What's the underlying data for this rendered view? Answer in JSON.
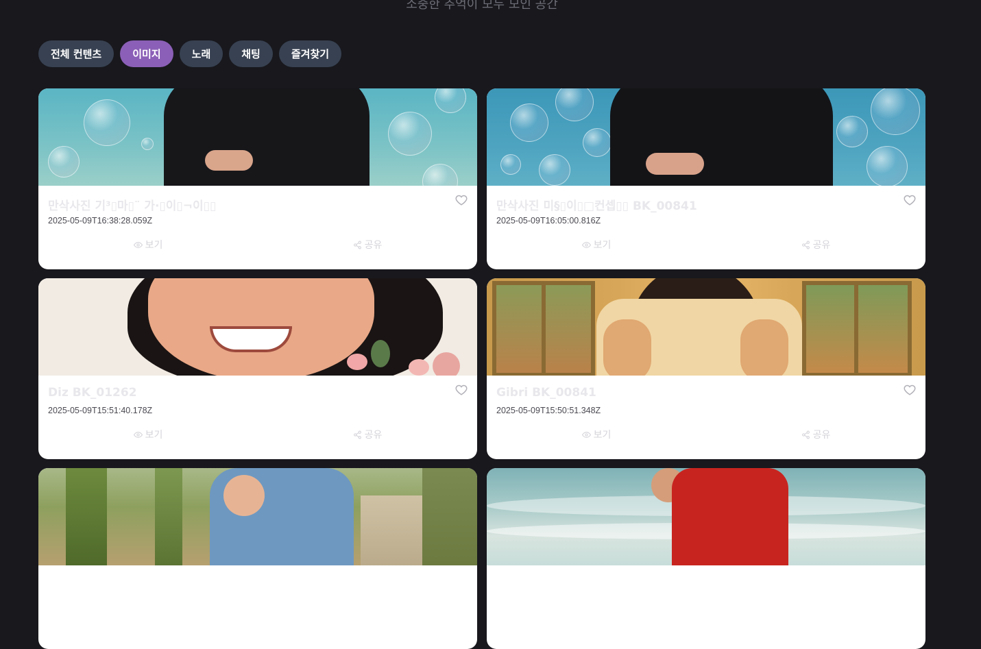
{
  "header": {
    "subtitle": "소중한 추억이 모두 모인 공간"
  },
  "tabs": [
    {
      "label": "전체 컨텐츠",
      "active": false
    },
    {
      "label": "이미지",
      "active": true
    },
    {
      "label": "노래",
      "active": false
    },
    {
      "label": "채팅",
      "active": false
    },
    {
      "label": "즐겨찾기",
      "active": false
    }
  ],
  "cards": [
    {
      "title": "만삭사진 기³▯마▯¨ 가·▯이▯¬이▯▯",
      "date": "2025-05-09T16:38:28.059Z",
      "view_label": "보기",
      "share_label": "공유"
    },
    {
      "title": "만삭사진 미§▯이▯□컨셉▯▯ BK_00841",
      "date": "2025-05-09T16:05:00.816Z",
      "view_label": "보기",
      "share_label": "공유"
    },
    {
      "title": "Diz BK_01262",
      "date": "2025-05-09T15:51:40.178Z",
      "view_label": "보기",
      "share_label": "공유"
    },
    {
      "title": "Gibri BK_00841",
      "date": "2025-05-09T15:50:51.348Z",
      "view_label": "보기",
      "share_label": "공유"
    },
    {
      "title": "",
      "date": "",
      "view_label": "",
      "share_label": ""
    },
    {
      "title": "",
      "date": "",
      "view_label": "",
      "share_label": ""
    }
  ],
  "colors": {
    "background": "#18181d",
    "tab": "#374151",
    "tab_active": "#8b5fb7",
    "card": "#ffffff"
  },
  "icons": {
    "heart": "heart-icon",
    "eye": "eye-icon",
    "share": "share-icon"
  }
}
